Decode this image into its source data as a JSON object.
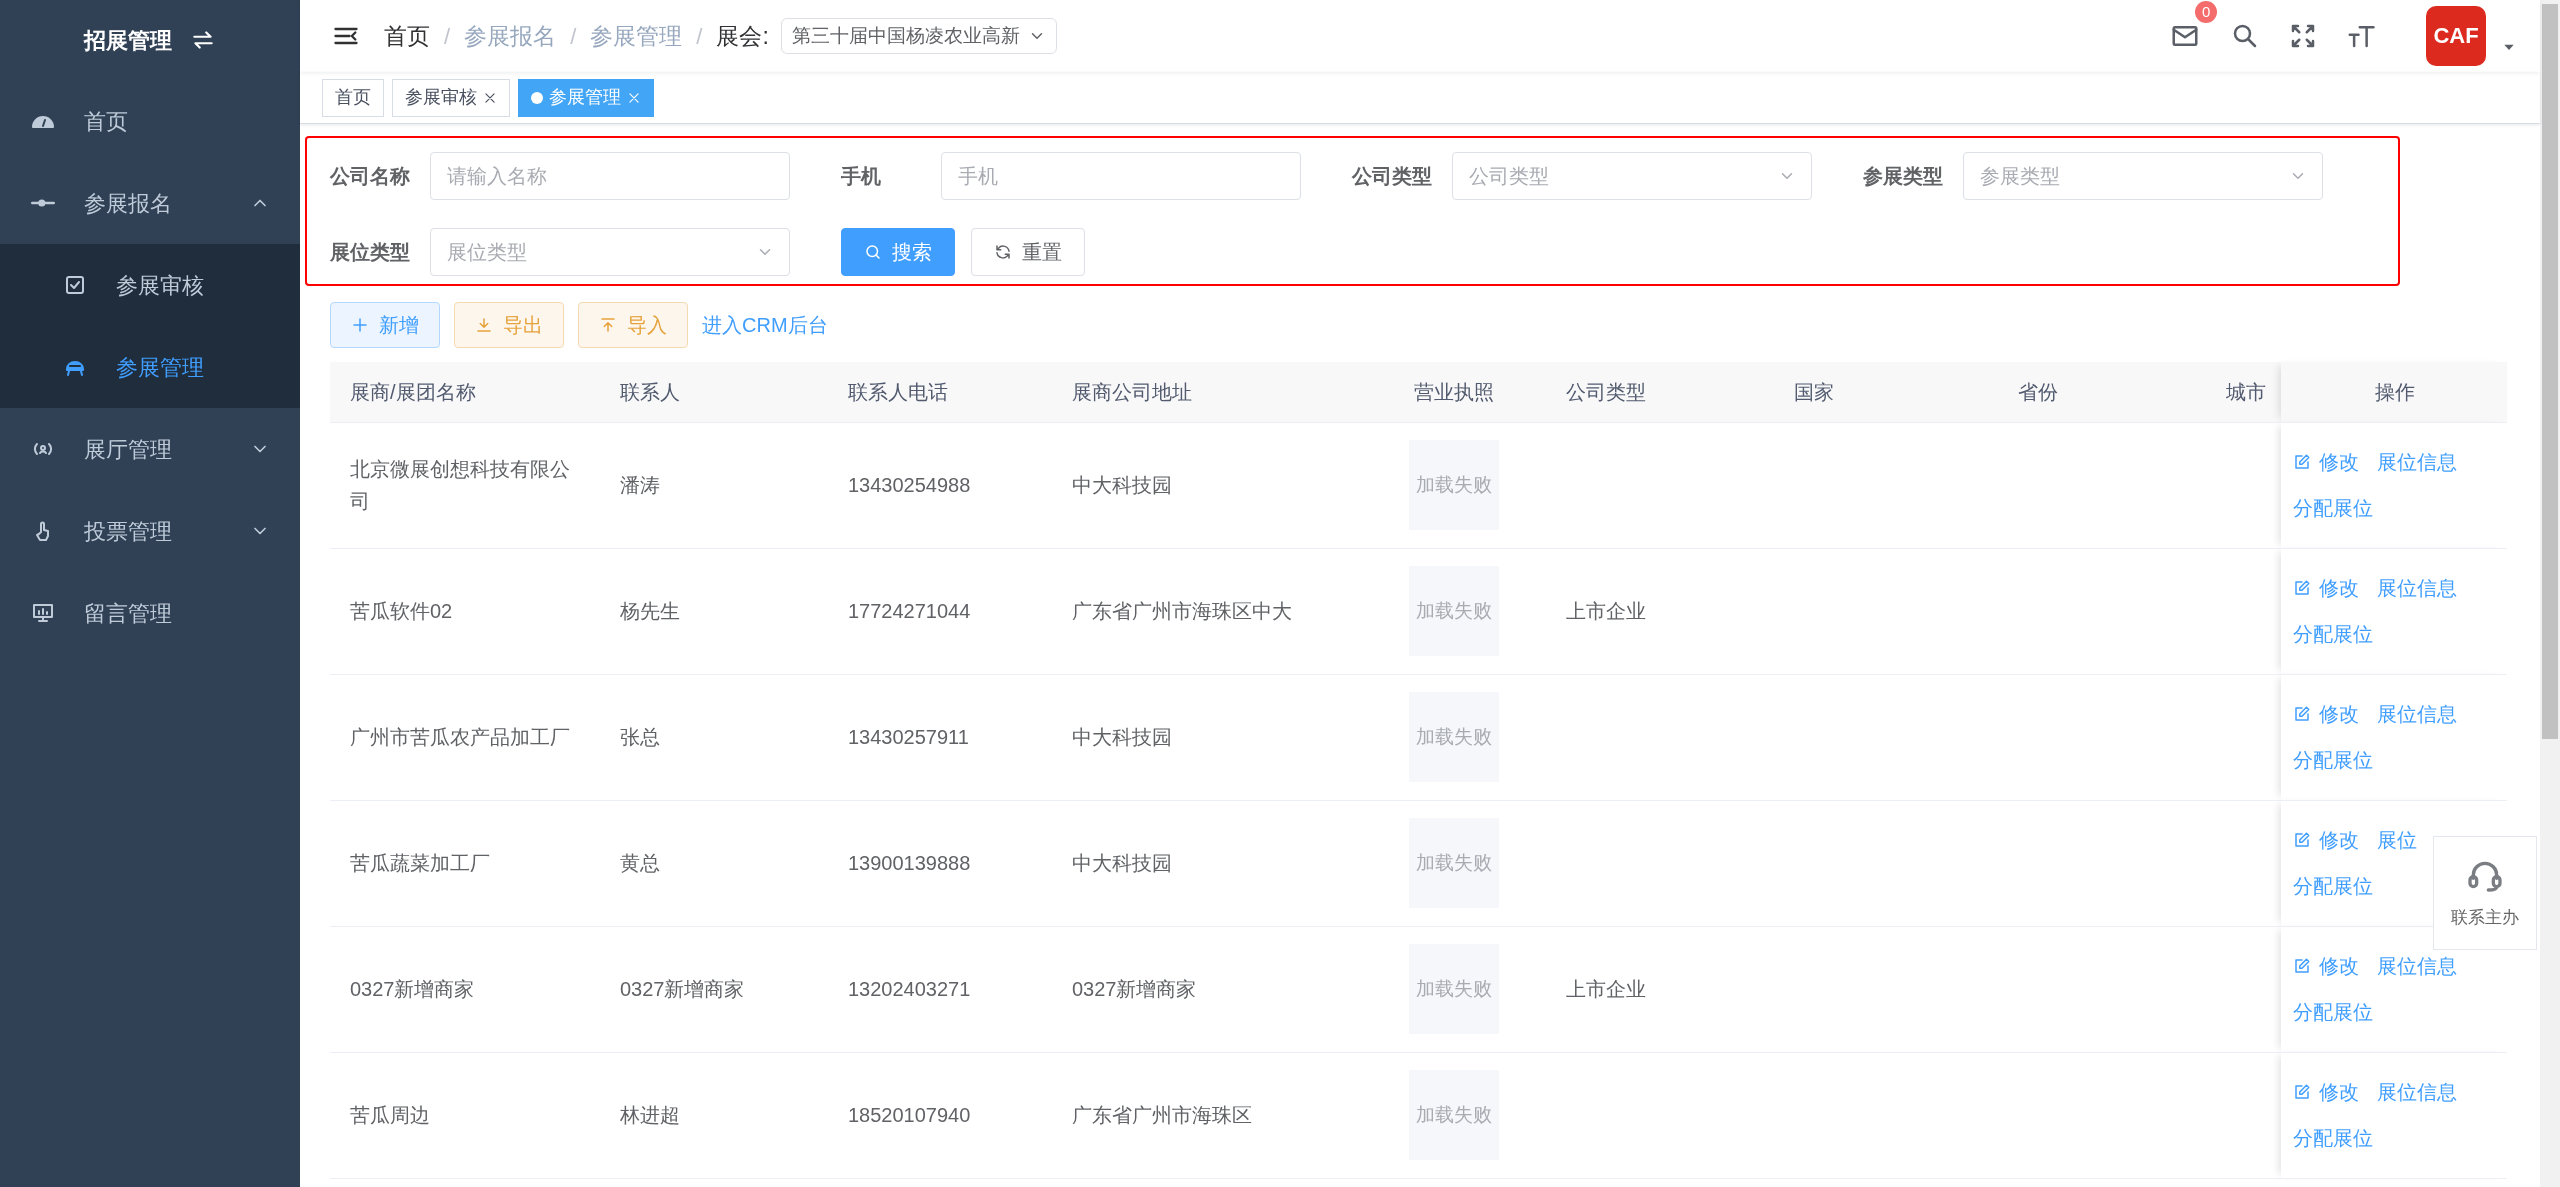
{
  "sidebar": {
    "title": "招展管理",
    "items": [
      {
        "label": "首页",
        "selected": false
      },
      {
        "label": "参展报名",
        "selected": false,
        "expanded": true,
        "children": [
          {
            "label": "参展审核",
            "selected": false
          },
          {
            "label": "参展管理",
            "selected": true
          }
        ]
      },
      {
        "label": "展厅管理",
        "selected": false,
        "expanded": false
      },
      {
        "label": "投票管理",
        "selected": false,
        "expanded": false
      },
      {
        "label": "留言管理",
        "selected": false
      }
    ]
  },
  "header": {
    "breadcrumb": [
      {
        "label": "首页",
        "muted": false
      },
      {
        "separator": "/",
        "label": "参展报名",
        "muted": true
      },
      {
        "separator": "/",
        "label": "参展管理",
        "muted": true
      }
    ],
    "exhibition": {
      "separator": "/",
      "label": "展会:",
      "value": "第三十届中国杨凌农业高新"
    },
    "notification_count": "0",
    "logo_text": "CAF"
  },
  "tabs": [
    {
      "label": "首页",
      "selected": false,
      "closable": false
    },
    {
      "label": "参展审核",
      "selected": false,
      "closable": true
    },
    {
      "label": "参展管理",
      "selected": true,
      "closable": true
    }
  ],
  "filters": [
    {
      "label": "公司名称",
      "placeholder": "请输入名称",
      "kind": "input"
    },
    {
      "label": "手机",
      "placeholder": "手机",
      "kind": "input"
    },
    {
      "label": "公司类型",
      "placeholder": "公司类型",
      "kind": "select"
    },
    {
      "label": "参展类型",
      "placeholder": "参展类型",
      "kind": "select"
    },
    {
      "label": "展位类型",
      "placeholder": "展位类型",
      "kind": "select"
    }
  ],
  "filter_buttons": [
    {
      "label": "搜索",
      "kind": "search"
    },
    {
      "label": "重置",
      "kind": "reset"
    }
  ],
  "actions": [
    {
      "label": "新增",
      "kind": "add"
    },
    {
      "label": "导出",
      "kind": "export"
    },
    {
      "label": "导入",
      "kind": "import"
    },
    {
      "label": "进入CRM后台",
      "kind": "link"
    }
  ],
  "table": {
    "columns": [
      "展商/展团名称",
      "联系人",
      "联系人电话",
      "展商公司地址",
      "营业执照",
      "公司类型",
      "国家",
      "省份",
      "城市",
      "操作"
    ],
    "rows": [
      {
        "cells": [
          "北京微展创想科技有限公司",
          "潘涛",
          "13430254988",
          "中大科技园",
          "加载失败",
          "",
          "",
          "",
          ""
        ],
        "actions": [
          {
            "label": "修改",
            "kind": "edit"
          },
          {
            "label": "展位信息",
            "kind": "link"
          },
          {
            "label": "分配展位",
            "kind": "link"
          }
        ]
      },
      {
        "cells": [
          "苦瓜软件02",
          "杨先生",
          "17724271044",
          "广东省广州市海珠区中大",
          "加载失败",
          "上市企业",
          "",
          "",
          ""
        ],
        "actions": [
          {
            "label": "修改",
            "kind": "edit"
          },
          {
            "label": "展位信息",
            "kind": "link"
          },
          {
            "label": "分配展位",
            "kind": "link"
          }
        ]
      },
      {
        "cells": [
          "广州市苦瓜农产品加工厂",
          "张总",
          "13430257911",
          "中大科技园",
          "加载失败",
          "",
          "",
          "",
          ""
        ],
        "actions": [
          {
            "label": "修改",
            "kind": "edit"
          },
          {
            "label": "展位信息",
            "kind": "link"
          },
          {
            "label": "分配展位",
            "kind": "link"
          }
        ]
      },
      {
        "cells": [
          "苦瓜蔬菜加工厂",
          "黄总",
          "13900139888",
          "中大科技园",
          "加载失败",
          "",
          "",
          "",
          ""
        ],
        "actions": [
          {
            "label": "修改",
            "kind": "edit"
          },
          {
            "label": "展位",
            "kind": "link"
          },
          {
            "label": "分配展位",
            "kind": "link"
          }
        ]
      },
      {
        "cells": [
          "0327新增商家",
          "0327新增商家",
          "13202403271",
          "0327新增商家",
          "加载失败",
          "上市企业",
          "",
          "",
          ""
        ],
        "actions": [
          {
            "label": "修改",
            "kind": "edit"
          },
          {
            "label": "展位信息",
            "kind": "link"
          },
          {
            "label": "分配展位",
            "kind": "link"
          }
        ]
      },
      {
        "cells": [
          "苦瓜周边",
          "林进超",
          "18520107940",
          "广东省广州市海珠区",
          "加载失败",
          "",
          "",
          "",
          ""
        ],
        "actions": [
          {
            "label": "修改",
            "kind": "edit"
          },
          {
            "label": "展位信息",
            "kind": "link"
          },
          {
            "label": "分配展位",
            "kind": "link"
          }
        ]
      }
    ]
  },
  "help_widget": {
    "label": "联系主办"
  }
}
